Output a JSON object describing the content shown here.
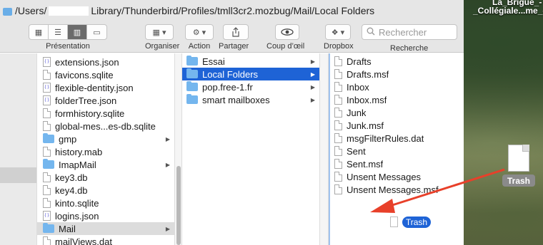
{
  "path": {
    "prefix": "/Users/",
    "suffix": "Library/Thunderbird/Profiles/tmll3cr2.mozbug/Mail/Local Folders"
  },
  "toolbar": {
    "presentation_label": "Présentation",
    "organiser_label": "Organiser",
    "action_label": "Action",
    "partager_label": "Partager",
    "coup_doeil_label": "Coup d’œil",
    "dropbox_label": "Dropbox",
    "recherche_label": "Recherche",
    "search_placeholder": "Rechercher"
  },
  "desktop": {
    "label_top": "La_Brigue_-",
    "label_second": "_Collégiale...me_-",
    "trash_label": "Trash",
    "drag_label": "Trash"
  },
  "column1": [
    {
      "label": "extensions.json",
      "kind": "json"
    },
    {
      "label": "favicons.sqlite",
      "kind": "doc"
    },
    {
      "label": "flexible-dentity.json",
      "kind": "json"
    },
    {
      "label": "folderTree.json",
      "kind": "json"
    },
    {
      "label": "formhistory.sqlite",
      "kind": "doc"
    },
    {
      "label": "global-mes...es-db.sqlite",
      "kind": "doc"
    },
    {
      "label": "gmp",
      "kind": "folder"
    },
    {
      "label": "history.mab",
      "kind": "doc"
    },
    {
      "label": "ImapMail",
      "kind": "folder"
    },
    {
      "label": "key3.db",
      "kind": "doc"
    },
    {
      "label": "key4.db",
      "kind": "doc"
    },
    {
      "label": "kinto.sqlite",
      "kind": "doc"
    },
    {
      "label": "logins.json",
      "kind": "json"
    },
    {
      "label": "Mail",
      "kind": "folder"
    },
    {
      "label": "mailViews.dat",
      "kind": "doc"
    }
  ],
  "column2": [
    {
      "label": "Essai",
      "kind": "folder"
    },
    {
      "label": "Local Folders",
      "kind": "folder"
    },
    {
      "label": "pop.free-1.fr",
      "kind": "folder"
    },
    {
      "label": "smart mailboxes",
      "kind": "folder"
    }
  ],
  "column3": [
    {
      "label": "Drafts"
    },
    {
      "label": "Drafts.msf"
    },
    {
      "label": "Inbox"
    },
    {
      "label": "Inbox.msf"
    },
    {
      "label": "Junk"
    },
    {
      "label": "Junk.msf"
    },
    {
      "label": "msgFilterRules.dat"
    },
    {
      "label": "Sent"
    },
    {
      "label": "Sent.msf"
    },
    {
      "label": "Unsent Messages"
    },
    {
      "label": "Unsent Messages.msf"
    }
  ],
  "colors": {
    "selection_active": "#1e63d6",
    "folder_blue": "#74b6ee",
    "arrow_red": "#e8402a"
  }
}
